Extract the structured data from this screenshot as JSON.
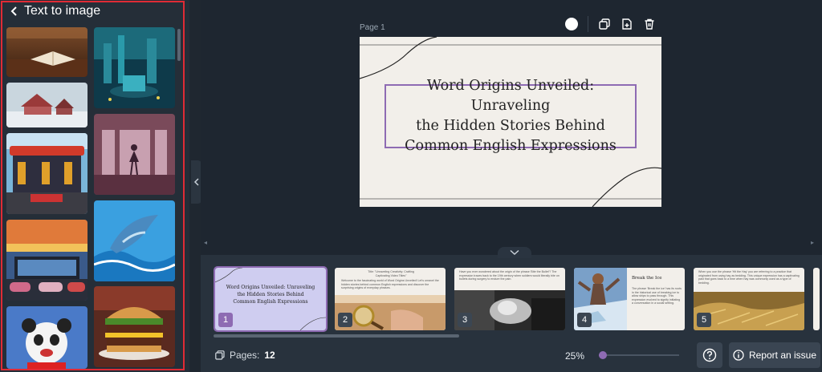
{
  "sidebar": {
    "title": "Text to image",
    "images": [
      {
        "name": "book-on-table-image",
        "desc_icon": "open-book"
      },
      {
        "name": "underwater-city-image",
        "desc_icon": "city"
      },
      {
        "name": "snowy-house-image",
        "desc_icon": "house"
      },
      {
        "name": "ballerina-room-image",
        "desc_icon": "ballerina"
      },
      {
        "name": "gas-station-image",
        "desc_icon": "station"
      },
      {
        "name": "dolphin-image",
        "desc_icon": "dolphin"
      },
      {
        "name": "retro-cars-image",
        "desc_icon": "cars"
      },
      {
        "name": "burger-image",
        "desc_icon": "burger"
      },
      {
        "name": "panda-image",
        "desc_icon": "panda"
      }
    ]
  },
  "editor": {
    "page_label": "Page 1",
    "slide_title": "Word Origins Unveiled: Unraveling\nthe Hidden Stories Behind\nCommon English Expressions",
    "toolbar_icons": [
      "color-dot",
      "duplicate-icon",
      "add-page-icon",
      "trash-icon"
    ]
  },
  "strip": {
    "slides": [
      {
        "num": "1",
        "title": "Word Origins Unveiled: Unraveling\nthe Hidden Stories Behind\nCommon English Expressions"
      },
      {
        "num": "2",
        "heading": "Title: \"Unraveling Creativity: Crafting\nCaptivating Video Titles\"",
        "text": "Welcome to the fascinating world of Word Origins Unveiled! Let's unravel the hidden stories behind common English expressions and discover the surprising origins of everyday phrases."
      },
      {
        "num": "3",
        "text": "Have you ever wondered about the origin of the phrase 'Bite the Bullet'? The expression traces back to the 19th century when soldiers would literally bite on bullets during surgery to endure the pain."
      },
      {
        "num": "4",
        "heading": "Break the Ice",
        "text": "The phrase 'Break the ice' has its roots in the historical use of breaking ice to allow ships to pass through. This expression evolved to signify initiating a conversation in a social setting."
      },
      {
        "num": "5",
        "text": "When you use the phrase 'Hit the Hay' you are referring to a practice that originated from using hay as bedding. This unique expression has a captivating past that goes back to a time when hay was commonly used as a type of bedding."
      }
    ]
  },
  "footer": {
    "pages_label": "Pages:",
    "pages_count": "12",
    "zoom": "25%",
    "zoom_fraction": 0.05,
    "report_label": "Report an issue"
  },
  "colors": {
    "accent": "#8e6bb3",
    "highlight_frame": "#e02b35",
    "canvas": "#f2efea"
  }
}
